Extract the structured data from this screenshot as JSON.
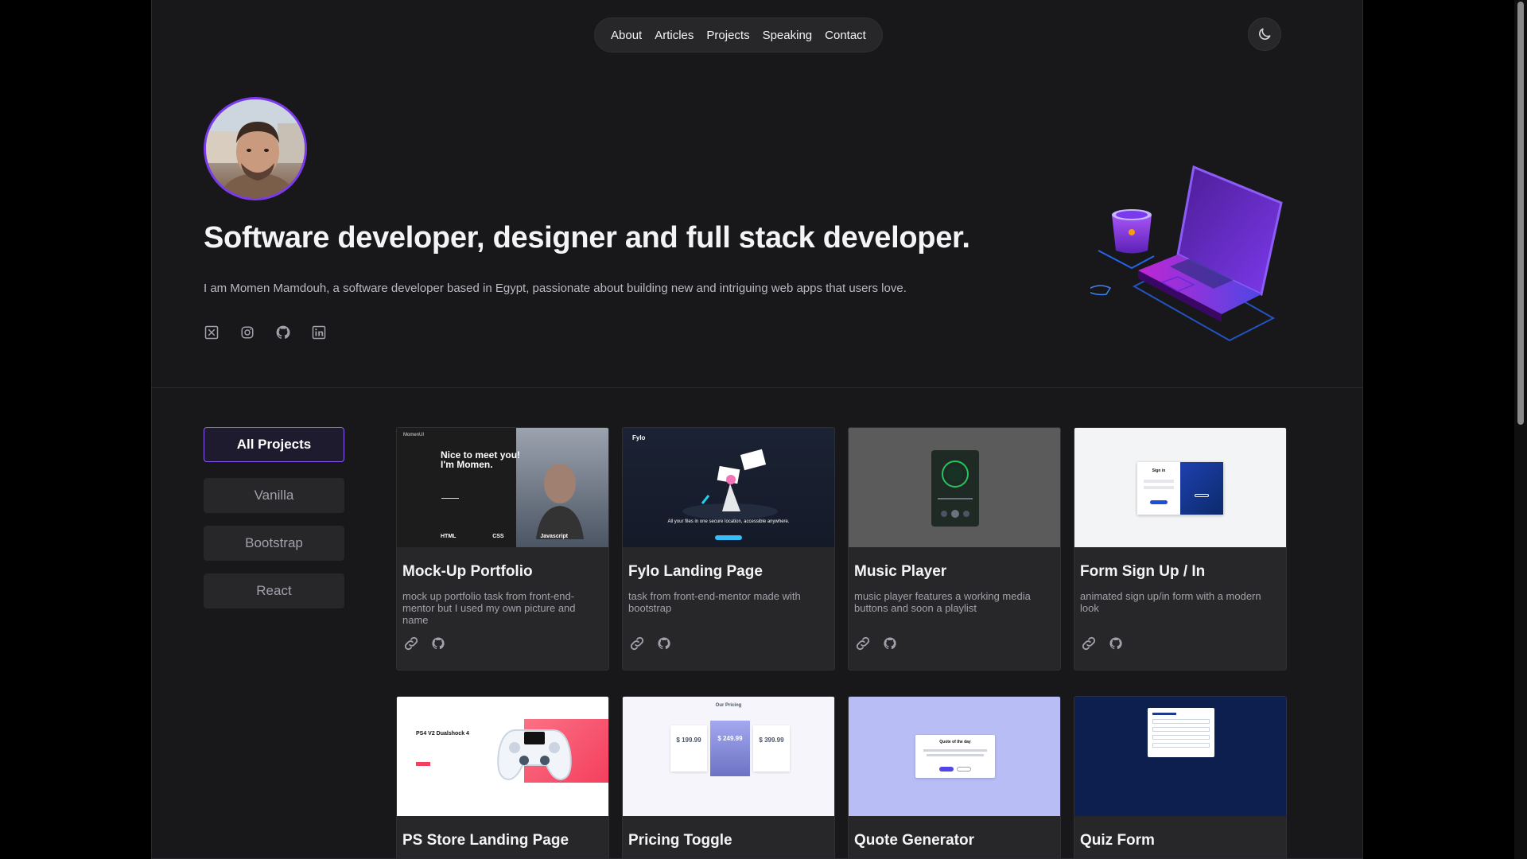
{
  "nav": {
    "items": [
      "About",
      "Articles",
      "Projects",
      "Speaking",
      "Contact"
    ]
  },
  "hero": {
    "title": "Software developer, designer and full stack developer.",
    "text": "I am Momen Mamdouh, a software developer based in Egypt, passionate about building new and intriguing web apps that users love.",
    "socials": [
      "x-icon",
      "instagram-icon",
      "github-icon",
      "linkedin-icon"
    ]
  },
  "filters": [
    "All Projects",
    "Vanilla",
    "Bootstrap",
    "React"
  ],
  "projects": [
    {
      "title": "Mock-Up Portfolio",
      "desc": "mock up portfolio task from front-end-mentor but I used my own picture and name",
      "thumb": {
        "kind": "portfolio",
        "logo": "MomenUI",
        "headline": "Nice to meet you! I'm Momen.",
        "skills": [
          "HTML",
          "CSS",
          "Javascript"
        ]
      }
    },
    {
      "title": "Fylo Landing Page",
      "desc": "task from front-end-mentor made with bootstrap",
      "thumb": {
        "kind": "fylo",
        "logo": "Fylo",
        "headline": "All your files in one secure location, accessible anywhere."
      }
    },
    {
      "title": "Music Player",
      "desc": "music player features a working media buttons and soon a playlist",
      "thumb": {
        "kind": "music"
      }
    },
    {
      "title": "Form Sign Up / In",
      "desc": "animated sign up/in form with a modern look",
      "thumb": {
        "kind": "form",
        "heading": "Sign in"
      }
    },
    {
      "title": "PS Store Landing Page",
      "desc": "",
      "thumb": {
        "kind": "ps",
        "headline": "PS4 V2 Dualshock 4"
      }
    },
    {
      "title": "Pricing Toggle",
      "desc": "",
      "thumb": {
        "kind": "pricing",
        "heading": "Our Pricing",
        "prices": [
          "$ 199.99",
          "$ 249.99",
          "$ 399.99"
        ]
      }
    },
    {
      "title": "Quote Generator",
      "desc": "",
      "thumb": {
        "kind": "quote",
        "heading": "Quote of the day"
      }
    },
    {
      "title": "Quiz Form",
      "desc": "",
      "thumb": {
        "kind": "quiz"
      }
    }
  ],
  "colors": {
    "accent": "#8b5cf6",
    "page_bg": "#18181b",
    "card_bg": "#27272a"
  }
}
